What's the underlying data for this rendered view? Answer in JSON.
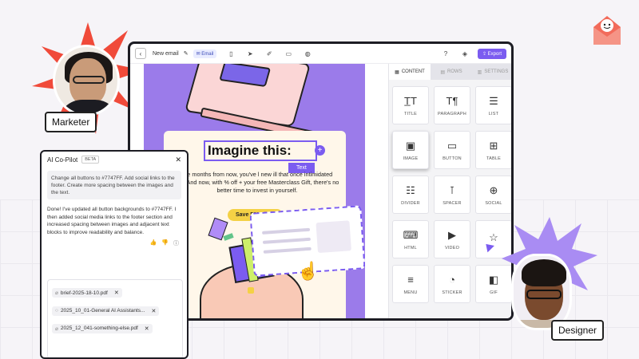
{
  "colors": {
    "accent": "#7b5cf0",
    "canvas": "#9b7bea",
    "button_yellow": "#f4d145"
  },
  "toolbar": {
    "back_icon": "chevron-left-icon",
    "title": "New email",
    "title_icon": "pencil-icon",
    "email_pill": "Email",
    "icons": [
      "document-icon",
      "send-icon",
      "pen-icon",
      "comment-icon",
      "globe-icon"
    ],
    "right_icons": [
      "help-icon",
      "shield-icon"
    ],
    "export_label": "Export"
  },
  "email": {
    "headline": "Imagine this:",
    "text_tag": "Text",
    "body": "ree months from now, you've l         new ill that once intimidated you.And now, with % off + your free Masterclass Gift, there's no better time to invest in yourself.",
    "save_button": "Save 50% Now"
  },
  "panel": {
    "tabs": [
      "CONTENT",
      "ROWS",
      "SETTINGS"
    ],
    "tiles": [
      {
        "label": "TITLE",
        "glyph": "T̲T"
      },
      {
        "label": "PARAGRAPH",
        "glyph": "T¶"
      },
      {
        "label": "LIST",
        "glyph": "☰"
      },
      {
        "label": "IMAGE",
        "glyph": "▣"
      },
      {
        "label": "BUTTON",
        "glyph": "▭"
      },
      {
        "label": "TABLE",
        "glyph": "⊞"
      },
      {
        "label": "DIVIDER",
        "glyph": "☷"
      },
      {
        "label": "SPACER",
        "glyph": "⊺"
      },
      {
        "label": "SOCIAL",
        "glyph": "⊕"
      },
      {
        "label": "HTML",
        "glyph": "⌨"
      },
      {
        "label": "VIDEO",
        "glyph": "▶"
      },
      {
        "label": "",
        "glyph": "☆"
      },
      {
        "label": "MENU",
        "glyph": "≡"
      },
      {
        "label": "STICKER",
        "glyph": "◔"
      },
      {
        "label": "GIF",
        "glyph": "◧"
      }
    ]
  },
  "copilot": {
    "title": "AI Co-Pilot",
    "badge": "BETA",
    "prompt": "Change all buttons to #7747FF. Add social links to the footer. Create more spacing between the images and the text.",
    "reply": "Done! I've updated all button backgrounds to #7747FF. I then added social media links to the footer section and increased spacing between images and adjacent text blocks to improve readability and balance.",
    "files": [
      "brief-2025-18-10.pdf",
      "2025_10_01-General AI Assistants...",
      "2025_12_041-something-else.pdf"
    ]
  },
  "people": {
    "marketer": "Marketer",
    "designer": "Designer"
  }
}
